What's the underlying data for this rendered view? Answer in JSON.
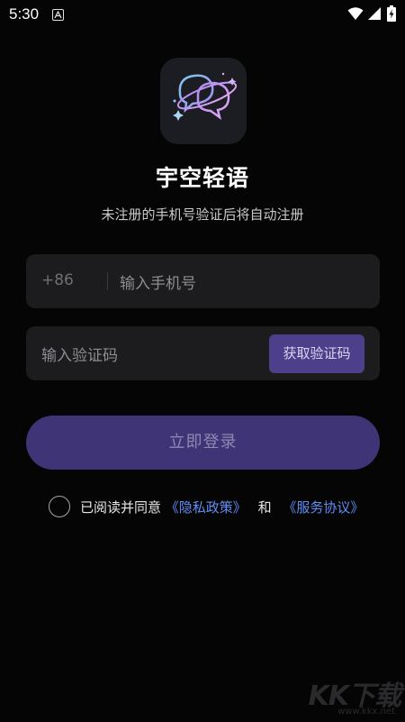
{
  "status_bar": {
    "time": "5:30",
    "icons": [
      "app-notification-icon",
      "wifi-icon",
      "signal-icon",
      "battery-charging-icon"
    ]
  },
  "app": {
    "logo_icon": "chat-bubbles-planet-icon",
    "name": "宇空轻语",
    "subtitle": "未注册的手机号验证后将自动注册"
  },
  "form": {
    "country_code": "+86",
    "phone_placeholder": "输入手机号",
    "code_placeholder": "输入验证码",
    "get_code_label": "获取验证码",
    "login_label": "立即登录"
  },
  "agreement": {
    "checked": false,
    "prefix": "已阅读并同意",
    "privacy_link": "《隐私政策》",
    "and": "和",
    "service_link": "《服务协议》"
  },
  "watermark": {
    "logo": "KK下载",
    "url": "www.kkx.net"
  },
  "colors": {
    "background": "#050506",
    "field": "#1c1c1f",
    "accent": "#4d3f8a",
    "login_button": "#3f3475",
    "link": "#5e8ef2"
  }
}
